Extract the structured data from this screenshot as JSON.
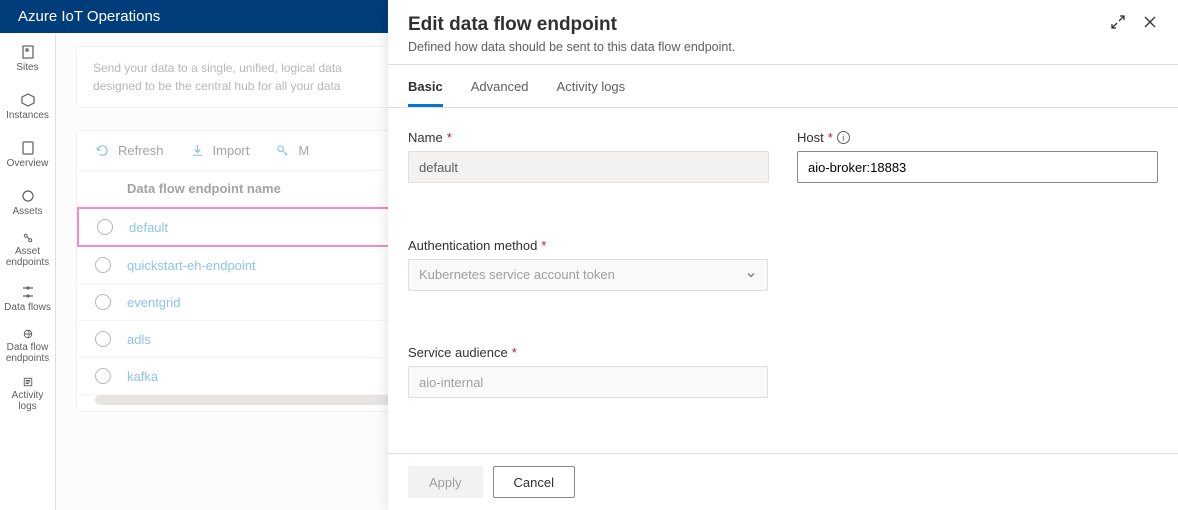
{
  "header": {
    "title": "Azure IoT Operations"
  },
  "sidebar": {
    "items": [
      {
        "label": "Sites"
      },
      {
        "label": "Instances"
      },
      {
        "label": "Overview"
      },
      {
        "label": "Assets"
      },
      {
        "label": "Asset endpoints"
      },
      {
        "label": "Data flows"
      },
      {
        "label": "Data flow endpoints"
      },
      {
        "label": "Activity logs"
      }
    ]
  },
  "info_card": {
    "line1": "Send your data to a single, unified, logical data",
    "line2": "designed to be the central hub for all your data"
  },
  "toolbar": {
    "refresh": "Refresh",
    "import": "Import",
    "manage": "M"
  },
  "table": {
    "header": "Data flow endpoint name",
    "rows": [
      {
        "name": "default",
        "highlight": true
      },
      {
        "name": "quickstart-eh-endpoint"
      },
      {
        "name": "eventgrid"
      },
      {
        "name": "adls"
      },
      {
        "name": "kafka"
      }
    ]
  },
  "panel": {
    "title": "Edit data flow endpoint",
    "subtitle": "Defined how data should be sent to this data flow endpoint.",
    "tabs": [
      {
        "label": "Basic",
        "active": true
      },
      {
        "label": "Advanced"
      },
      {
        "label": "Activity logs"
      }
    ],
    "form": {
      "name_label": "Name",
      "name_value": "default",
      "host_label": "Host",
      "host_value": "aio-broker:18883",
      "auth_label": "Authentication method",
      "auth_value": "Kubernetes service account token",
      "audience_label": "Service audience",
      "audience_value": "aio-internal"
    },
    "footer": {
      "apply": "Apply",
      "cancel": "Cancel"
    }
  }
}
